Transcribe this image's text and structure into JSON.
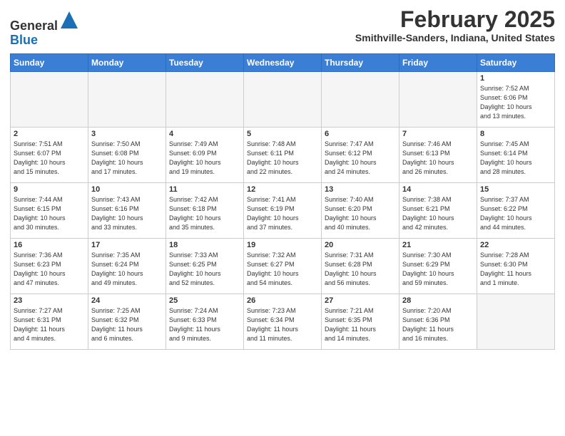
{
  "header": {
    "logo_general": "General",
    "logo_blue": "Blue",
    "month_title": "February 2025",
    "location": "Smithville-Sanders, Indiana, United States"
  },
  "weekdays": [
    "Sunday",
    "Monday",
    "Tuesday",
    "Wednesday",
    "Thursday",
    "Friday",
    "Saturday"
  ],
  "weeks": [
    [
      {
        "day": "",
        "info": ""
      },
      {
        "day": "",
        "info": ""
      },
      {
        "day": "",
        "info": ""
      },
      {
        "day": "",
        "info": ""
      },
      {
        "day": "",
        "info": ""
      },
      {
        "day": "",
        "info": ""
      },
      {
        "day": "1",
        "info": "Sunrise: 7:52 AM\nSunset: 6:06 PM\nDaylight: 10 hours\nand 13 minutes."
      }
    ],
    [
      {
        "day": "2",
        "info": "Sunrise: 7:51 AM\nSunset: 6:07 PM\nDaylight: 10 hours\nand 15 minutes."
      },
      {
        "day": "3",
        "info": "Sunrise: 7:50 AM\nSunset: 6:08 PM\nDaylight: 10 hours\nand 17 minutes."
      },
      {
        "day": "4",
        "info": "Sunrise: 7:49 AM\nSunset: 6:09 PM\nDaylight: 10 hours\nand 19 minutes."
      },
      {
        "day": "5",
        "info": "Sunrise: 7:48 AM\nSunset: 6:11 PM\nDaylight: 10 hours\nand 22 minutes."
      },
      {
        "day": "6",
        "info": "Sunrise: 7:47 AM\nSunset: 6:12 PM\nDaylight: 10 hours\nand 24 minutes."
      },
      {
        "day": "7",
        "info": "Sunrise: 7:46 AM\nSunset: 6:13 PM\nDaylight: 10 hours\nand 26 minutes."
      },
      {
        "day": "8",
        "info": "Sunrise: 7:45 AM\nSunset: 6:14 PM\nDaylight: 10 hours\nand 28 minutes."
      }
    ],
    [
      {
        "day": "9",
        "info": "Sunrise: 7:44 AM\nSunset: 6:15 PM\nDaylight: 10 hours\nand 30 minutes."
      },
      {
        "day": "10",
        "info": "Sunrise: 7:43 AM\nSunset: 6:16 PM\nDaylight: 10 hours\nand 33 minutes."
      },
      {
        "day": "11",
        "info": "Sunrise: 7:42 AM\nSunset: 6:18 PM\nDaylight: 10 hours\nand 35 minutes."
      },
      {
        "day": "12",
        "info": "Sunrise: 7:41 AM\nSunset: 6:19 PM\nDaylight: 10 hours\nand 37 minutes."
      },
      {
        "day": "13",
        "info": "Sunrise: 7:40 AM\nSunset: 6:20 PM\nDaylight: 10 hours\nand 40 minutes."
      },
      {
        "day": "14",
        "info": "Sunrise: 7:38 AM\nSunset: 6:21 PM\nDaylight: 10 hours\nand 42 minutes."
      },
      {
        "day": "15",
        "info": "Sunrise: 7:37 AM\nSunset: 6:22 PM\nDaylight: 10 hours\nand 44 minutes."
      }
    ],
    [
      {
        "day": "16",
        "info": "Sunrise: 7:36 AM\nSunset: 6:23 PM\nDaylight: 10 hours\nand 47 minutes."
      },
      {
        "day": "17",
        "info": "Sunrise: 7:35 AM\nSunset: 6:24 PM\nDaylight: 10 hours\nand 49 minutes."
      },
      {
        "day": "18",
        "info": "Sunrise: 7:33 AM\nSunset: 6:25 PM\nDaylight: 10 hours\nand 52 minutes."
      },
      {
        "day": "19",
        "info": "Sunrise: 7:32 AM\nSunset: 6:27 PM\nDaylight: 10 hours\nand 54 minutes."
      },
      {
        "day": "20",
        "info": "Sunrise: 7:31 AM\nSunset: 6:28 PM\nDaylight: 10 hours\nand 56 minutes."
      },
      {
        "day": "21",
        "info": "Sunrise: 7:30 AM\nSunset: 6:29 PM\nDaylight: 10 hours\nand 59 minutes."
      },
      {
        "day": "22",
        "info": "Sunrise: 7:28 AM\nSunset: 6:30 PM\nDaylight: 11 hours\nand 1 minute."
      }
    ],
    [
      {
        "day": "23",
        "info": "Sunrise: 7:27 AM\nSunset: 6:31 PM\nDaylight: 11 hours\nand 4 minutes."
      },
      {
        "day": "24",
        "info": "Sunrise: 7:25 AM\nSunset: 6:32 PM\nDaylight: 11 hours\nand 6 minutes."
      },
      {
        "day": "25",
        "info": "Sunrise: 7:24 AM\nSunset: 6:33 PM\nDaylight: 11 hours\nand 9 minutes."
      },
      {
        "day": "26",
        "info": "Sunrise: 7:23 AM\nSunset: 6:34 PM\nDaylight: 11 hours\nand 11 minutes."
      },
      {
        "day": "27",
        "info": "Sunrise: 7:21 AM\nSunset: 6:35 PM\nDaylight: 11 hours\nand 14 minutes."
      },
      {
        "day": "28",
        "info": "Sunrise: 7:20 AM\nSunset: 6:36 PM\nDaylight: 11 hours\nand 16 minutes."
      },
      {
        "day": "",
        "info": ""
      }
    ]
  ]
}
